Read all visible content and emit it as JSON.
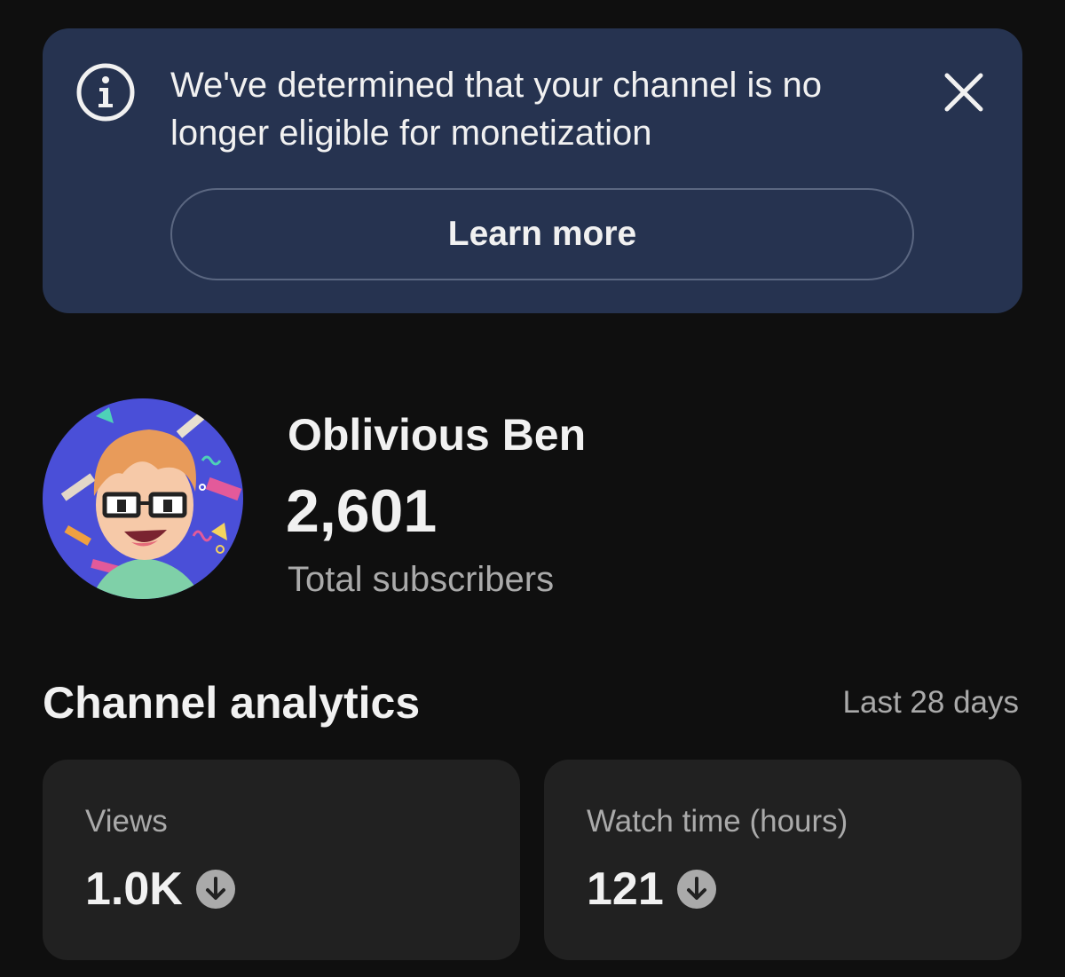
{
  "banner": {
    "message": "We've determined that your channel is no longer eligible for monetization",
    "learn_more_label": "Learn more",
    "info_icon": "info-icon",
    "close_icon": "close-icon"
  },
  "channel": {
    "name": "Oblivious Ben",
    "subscriber_count": "2,601",
    "subscriber_label": "Total subscribers",
    "avatar_icon": "avatar"
  },
  "analytics": {
    "title": "Channel analytics",
    "period": "Last 28 days",
    "cards": [
      {
        "label": "Views",
        "value": "1.0K",
        "trend": "down",
        "trend_icon": "arrow-down-circle-icon"
      },
      {
        "label": "Watch time (hours)",
        "value": "121",
        "trend": "down",
        "trend_icon": "arrow-down-circle-icon"
      }
    ]
  },
  "colors": {
    "background": "#0f0f0f",
    "banner": "#263350",
    "card": "#212121",
    "secondary_text": "#aaaaaa",
    "primary_text": "#f1f1f1"
  }
}
